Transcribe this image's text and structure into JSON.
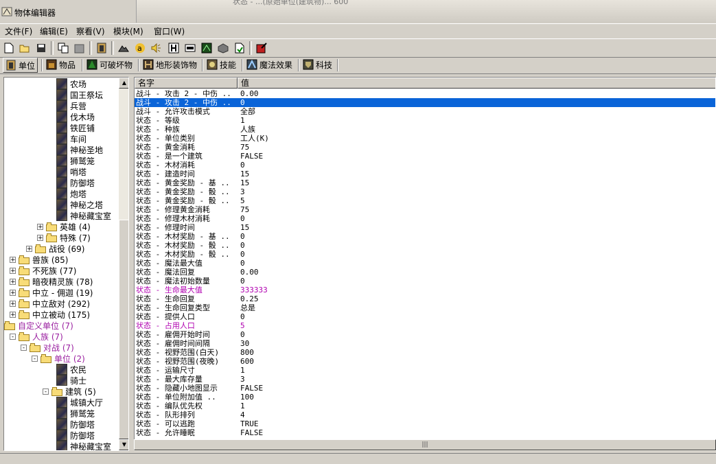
{
  "window": {
    "title": "物体编辑器",
    "bg_ghost_text": "状态 - ...(原始单位(建筑物)... 600"
  },
  "menu": [
    {
      "label": "文件(F)"
    },
    {
      "label": "编辑(E)"
    },
    {
      "label": "察看(V)"
    },
    {
      "label": "模块(M)"
    },
    {
      "label": "窗口(W)"
    }
  ],
  "toolbar": {
    "icons": [
      "new-file-icon",
      "open-folder-icon",
      "save-icon",
      "copy-icon",
      "paste-icon",
      "unit-editor-icon",
      "terrain-icon",
      "sound-icon",
      "speaker-icon",
      "model-icon",
      "text-icon",
      "image-icon",
      "import-icon",
      "export-icon",
      "test-map-icon"
    ]
  },
  "tabs": [
    {
      "label": "单位",
      "icon": "unit-tab-icon",
      "active": true
    },
    {
      "label": "物品",
      "icon": "item-tab-icon",
      "active": false
    },
    {
      "label": "可破坏物",
      "icon": "destructible-tab-icon",
      "active": false
    },
    {
      "label": "地形装饰物",
      "icon": "doodad-tab-icon",
      "active": false
    },
    {
      "label": "技能",
      "icon": "ability-tab-icon",
      "active": false
    },
    {
      "label": "魔法效果",
      "icon": "buff-tab-icon",
      "active": false
    },
    {
      "label": "科技",
      "icon": "upgrade-tab-icon",
      "active": false
    }
  ],
  "tree": [
    {
      "label": "农场",
      "type": "unit"
    },
    {
      "label": "国王祭坛",
      "type": "unit"
    },
    {
      "label": "兵营",
      "type": "unit"
    },
    {
      "label": "伐木场",
      "type": "unit"
    },
    {
      "label": "铁匠铺",
      "type": "unit"
    },
    {
      "label": "车间",
      "type": "unit"
    },
    {
      "label": "神秘圣地",
      "type": "unit"
    },
    {
      "label": "狮鹫笼",
      "type": "unit"
    },
    {
      "label": "哨塔",
      "type": "unit"
    },
    {
      "label": "防御塔",
      "type": "unit"
    },
    {
      "label": "炮塔",
      "type": "unit"
    },
    {
      "label": "神秘之塔",
      "type": "unit"
    },
    {
      "label": "神秘藏宝室",
      "type": "unit"
    },
    {
      "label": "英雄 (4)",
      "type": "folder",
      "exp": "+"
    },
    {
      "label": "特殊 (7)",
      "type": "folder",
      "exp": "+"
    },
    {
      "label": "战役 (69)",
      "type": "folder",
      "exp": "+"
    },
    {
      "label": "兽族 (85)",
      "type": "folder",
      "exp": "+"
    },
    {
      "label": "不死族 (77)",
      "type": "folder",
      "exp": "+"
    },
    {
      "label": "暗夜精灵族 (78)",
      "type": "folder",
      "exp": "+"
    },
    {
      "label": "中立 - 佣迦 (19)",
      "type": "folder",
      "exp": "+"
    },
    {
      "label": "中立敌对 (292)",
      "type": "folder",
      "exp": "+"
    },
    {
      "label": "中立被动 (175)",
      "type": "folder",
      "exp": "+"
    },
    {
      "label": "自定义单位 (7)",
      "type": "folder",
      "purple": true
    },
    {
      "label": "人族 (7)",
      "type": "folder",
      "exp": "-",
      "purple": true
    },
    {
      "label": "对战 (7)",
      "type": "folder",
      "exp": "-",
      "purple": true
    },
    {
      "label": "单位 (2)",
      "type": "folder",
      "exp": "-",
      "purple": true
    },
    {
      "label": "农民",
      "type": "unit"
    },
    {
      "label": "骑士",
      "type": "unit"
    },
    {
      "label": "建筑 (5)",
      "type": "folder",
      "exp": "-"
    },
    {
      "label": "城镇大厅",
      "type": "unit"
    },
    {
      "label": "狮鹫笼",
      "type": "unit"
    },
    {
      "label": "防御塔",
      "type": "unit"
    },
    {
      "label": "防御塔",
      "type": "unit"
    },
    {
      "label": "神秘藏宝室",
      "type": "unit"
    }
  ],
  "list": {
    "col_name": "名字",
    "col_value": "值",
    "rows": [
      {
        "k": "战斗 - 攻击 2 - 中伤 ..",
        "v": "0.00"
      },
      {
        "k": "战斗 - 攻击 2 - 中伤 ..",
        "v": "0",
        "sel": true
      },
      {
        "k": "战斗 - 允许攻击模式",
        "v": "全部"
      },
      {
        "k": "状态 - 等级",
        "v": "1"
      },
      {
        "k": "状态 - 种族",
        "v": "人族"
      },
      {
        "k": "状态 - 单位类别",
        "v": "工人(K)"
      },
      {
        "k": "状态 - 黄金消耗",
        "v": "75"
      },
      {
        "k": "状态 - 是一个建筑",
        "v": "FALSE"
      },
      {
        "k": "状态 - 木材消耗",
        "v": "0"
      },
      {
        "k": "状态 - 建造时间",
        "v": "15"
      },
      {
        "k": "状态 - 黄金奖励 - 基 ..",
        "v": "15"
      },
      {
        "k": "状态 - 黄金奖励 - 骰 ..",
        "v": "3"
      },
      {
        "k": "状态 - 黄金奖励 - 骰 ..",
        "v": "5"
      },
      {
        "k": "状态 - 修理黄金消耗",
        "v": "75"
      },
      {
        "k": "状态 - 修理木材消耗",
        "v": "0"
      },
      {
        "k": "状态 - 修理时间",
        "v": "15"
      },
      {
        "k": "状态 - 木材奖励 - 基 ..",
        "v": "0"
      },
      {
        "k": "状态 - 木材奖励 - 骰 ..",
        "v": "0"
      },
      {
        "k": "状态 - 木材奖励 - 骰 ..",
        "v": "0"
      },
      {
        "k": "状态 - 魔法最大值",
        "v": "0"
      },
      {
        "k": "状态 - 魔法回复",
        "v": "0.00"
      },
      {
        "k": "状态 - 魔法初始数量",
        "v": "0"
      },
      {
        "k": "状态 - 生命最大值",
        "v": "333333",
        "purple": true
      },
      {
        "k": "状态 - 生命回复",
        "v": "0.25"
      },
      {
        "k": "状态 - 生命回复类型",
        "v": "总是"
      },
      {
        "k": "状态 - 提供人口",
        "v": "0"
      },
      {
        "k": "状态 - 占用人口",
        "v": "5",
        "purple": true
      },
      {
        "k": "状态 - 雇佣开始时间",
        "v": "0"
      },
      {
        "k": "状态 - 雇佣时间间隔",
        "v": "30"
      },
      {
        "k": "状态 - 视野范围(白天)",
        "v": "800"
      },
      {
        "k": "状态 - 视野范围(夜晚)",
        "v": "600"
      },
      {
        "k": "状态 - 运输尺寸",
        "v": "1"
      },
      {
        "k": "状态 - 最大库存量",
        "v": "3"
      },
      {
        "k": "状态 - 隐藏小地图显示",
        "v": "FALSE"
      },
      {
        "k": "状态 - 单位附加值    ..",
        "v": "100"
      },
      {
        "k": "状态 - 编队优先权",
        "v": "1"
      },
      {
        "k": "状态 - 队形排列",
        "v": "4"
      },
      {
        "k": "状态 - 可以逃跑",
        "v": "TRUE"
      },
      {
        "k": "状态 - 允许睡眠",
        "v": "FALSE"
      }
    ]
  },
  "hscroll_grip": "|||"
}
